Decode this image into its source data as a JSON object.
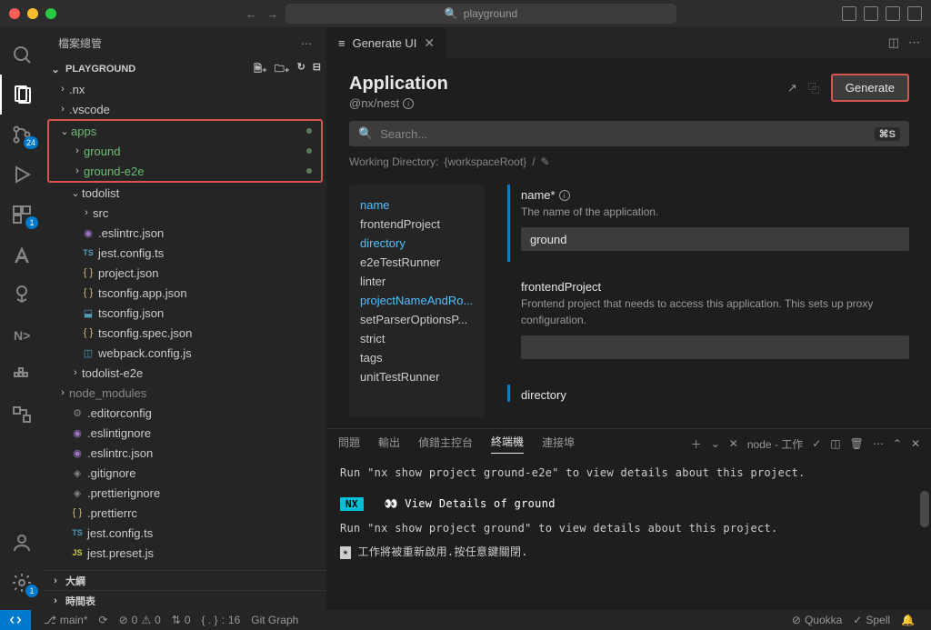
{
  "titlebar": {
    "search_text": "playground"
  },
  "sidebar": {
    "title": "檔案總管",
    "section": "PLAYGROUND"
  },
  "activity": {
    "scm_badge": "24",
    "ext_badge": "1",
    "gear_badge": "1"
  },
  "tree": {
    "nx": ".nx",
    "vscode": ".vscode",
    "apps": "apps",
    "ground": "ground",
    "ground_e2e": "ground-e2e",
    "todolist": "todolist",
    "src": "src",
    "eslintrc": ".eslintrc.json",
    "jest_config": "jest.config.ts",
    "project_json": "project.json",
    "tsconfig_app": "tsconfig.app.json",
    "tsconfig": "tsconfig.json",
    "tsconfig_spec": "tsconfig.spec.json",
    "webpack": "webpack.config.js",
    "todolist_e2e": "todolist-e2e",
    "node_modules": "node_modules",
    "editorconfig": ".editorconfig",
    "eslintignore": ".eslintignore",
    "eslintrc2": ".eslintrc.json",
    "gitignore": ".gitignore",
    "prettierignore": ".prettierignore",
    "prettierrc": ".prettierrc",
    "jest_config2": "jest.config.ts",
    "jest_preset": "jest.preset.js",
    "outline": "大綱",
    "timeline": "時間表"
  },
  "tab": {
    "label": "Generate UI"
  },
  "gen": {
    "title": "Application",
    "subtitle": "@nx/nest",
    "open_ext": "↗",
    "copy": "⿻",
    "button": "Generate",
    "search_placeholder": "Search...",
    "kbd": "⌘S",
    "wd_label": "Working Directory:",
    "wd_value": "{workspaceRoot}",
    "wd_edit": "✎"
  },
  "formnav": {
    "name": "name",
    "frontend": "frontendProject",
    "directory": "directory",
    "e2e": "e2eTestRunner",
    "linter": "linter",
    "projname": "projectNameAndRo...",
    "parser": "setParserOptionsP...",
    "strict": "strict",
    "tags": "tags",
    "unit": "unitTestRunner"
  },
  "fields": {
    "name_label": "name*",
    "name_desc": "The name of the application.",
    "name_value": "ground",
    "frontend_label": "frontendProject",
    "frontend_desc": "Frontend project that needs to access this application. This sets up proxy configuration.",
    "directory_label": "directory"
  },
  "panel": {
    "problems": "問題",
    "output": "輸出",
    "debug_console": "偵錯主控台",
    "terminal": "終端機",
    "ports": "連接埠",
    "task_label": "node - 工作"
  },
  "terminal": {
    "line1": "Run \"nx show project ground-e2e\" to view details about this project.",
    "nx_badge": "NX",
    "line2_symbol": "👀",
    "line2": "View Details of ground",
    "line3": "Run \"nx show project ground\" to view details about this project.",
    "line4": "工作將被重新啟用.按任意鍵關閉."
  },
  "statusbar": {
    "branch": "main*",
    "sync": "⟳",
    "errors": "0",
    "warnings": "0",
    "info": "0",
    "braces": "{ . }",
    "braces_count": "16",
    "git_graph": "Git Graph",
    "quokka": "Quokka",
    "spell": "Spell"
  }
}
